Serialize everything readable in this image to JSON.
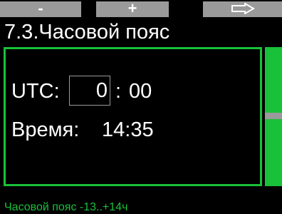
{
  "softkeys": {
    "left_label": "-",
    "center_label": "+",
    "right_icon": "right-arrow-outline-icon"
  },
  "title": "7.3.Часовой пояс",
  "utc": {
    "label": "UTC:",
    "hours": "0",
    "separator": ":",
    "minutes": "00"
  },
  "time": {
    "label": "Время:",
    "value": "14:35"
  },
  "footer": "Часовой пояс -13..+14ч",
  "colors": {
    "accent": "#19c13a",
    "softkey": "#9a9a9a",
    "background": "#000000",
    "text": "#ffffff"
  }
}
